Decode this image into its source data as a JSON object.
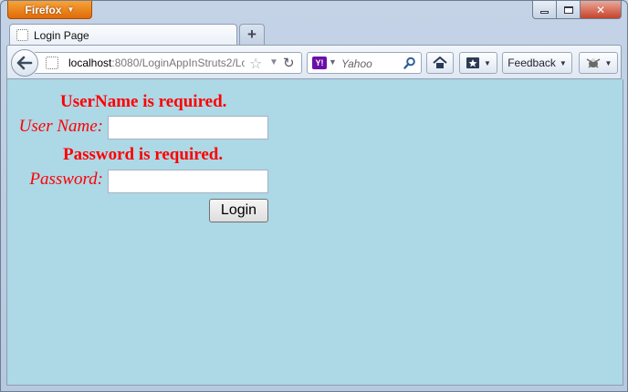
{
  "browser": {
    "app_button_label": "Firefox",
    "tab": {
      "title": "Login Page"
    },
    "new_tab_label": "+",
    "url": {
      "host": "localhost",
      "rest": ":8080/LoginAppInStruts2/Lo"
    },
    "search": {
      "placeholder": "Yahoo",
      "engine_logo": "Y!"
    },
    "feedback_label": "Feedback",
    "icons": {
      "back": "back-arrow-icon",
      "reload": "reload-icon",
      "bookmark_star": "star-icon",
      "home": "home-icon",
      "bookmarks": "bookmarks-icon",
      "addon": "addon-icon"
    }
  },
  "form": {
    "username_error": "UserName is required.",
    "username_label": "User Name:",
    "username_value": "",
    "password_error": "Password is required.",
    "password_label": "Password:",
    "password_value": "",
    "submit_label": "Login"
  },
  "colors": {
    "content_background": "#add8e6",
    "error_text": "#ff0000",
    "firefox_orange": "#e06b08"
  }
}
